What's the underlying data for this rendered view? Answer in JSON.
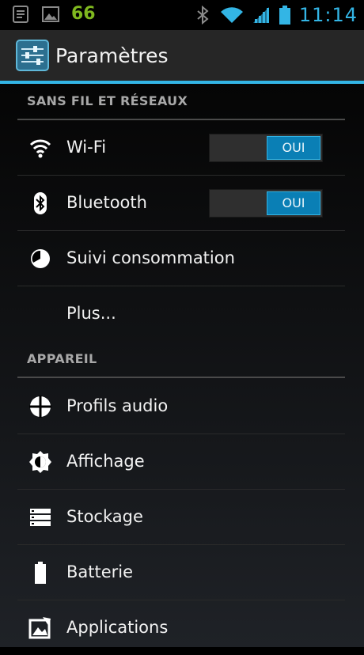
{
  "status_bar": {
    "notification_badge": "66",
    "time": "11:14"
  },
  "action_bar": {
    "title": "Paramètres"
  },
  "sections": [
    {
      "header": "SANS FIL ET RÉSEAUX",
      "items": [
        {
          "label": "Wi-Fi",
          "icon": "wifi-icon",
          "toggle": "OUI"
        },
        {
          "label": "Bluetooth",
          "icon": "bluetooth-icon",
          "toggle": "OUI"
        },
        {
          "label": "Suivi consommation",
          "icon": "data-usage-icon"
        },
        {
          "label": "Plus..."
        }
      ]
    },
    {
      "header": "APPAREIL",
      "items": [
        {
          "label": "Profils audio",
          "icon": "audio-profiles-icon"
        },
        {
          "label": "Affichage",
          "icon": "display-brightness-icon"
        },
        {
          "label": "Stockage",
          "icon": "storage-icon"
        },
        {
          "label": "Batterie",
          "icon": "battery-icon"
        },
        {
          "label": "Applications",
          "icon": "applications-icon"
        }
      ]
    }
  ],
  "colors": {
    "accent": "#33b5e5",
    "toggle_on": "#0a7fb5",
    "badge_green": "#7fb81f"
  }
}
